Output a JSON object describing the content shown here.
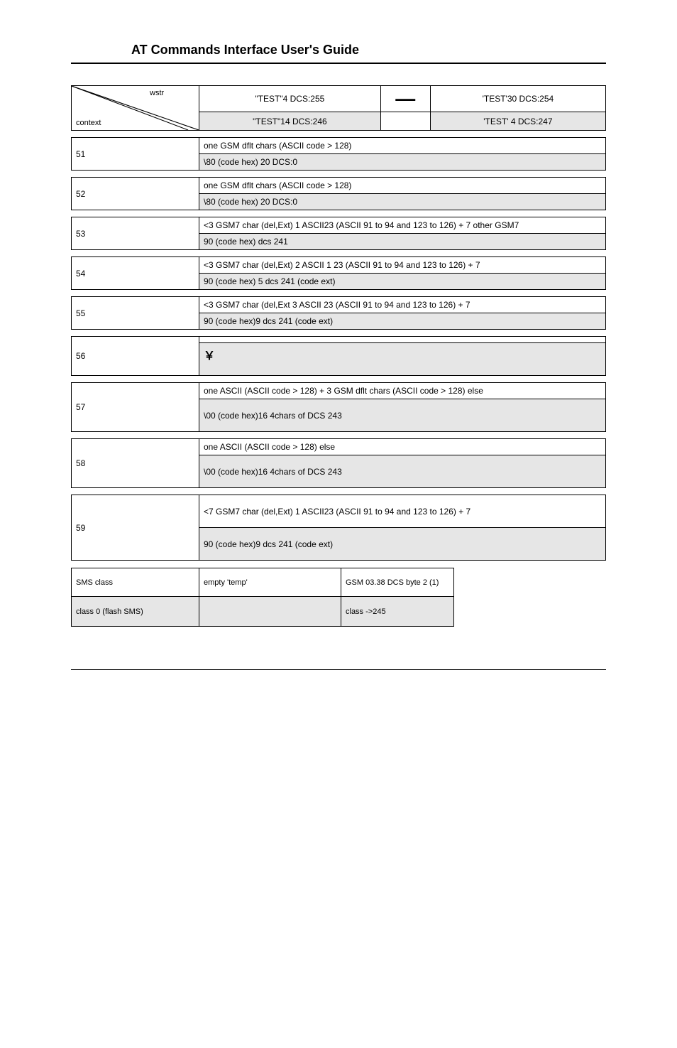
{
  "header": {
    "title": "AT Commands Interface User's Guide"
  },
  "diag": {
    "top": "wstr",
    "bottom": "context"
  },
  "columns": {
    "c1": "\"TEST\"4 DCS:255",
    "c2": "—",
    "c3": "'TEST'30 DCS:254"
  },
  "headrow2": {
    "c1": "\"TEST\"14 DCS:246",
    "c2": "",
    "c3": "'TEST' 4 DCS:247"
  },
  "sections": [
    {
      "num": "51",
      "white": "one GSM dflt chars (ASCII code > 128)",
      "grey": "\\80 (code hex) 20 DCS:0"
    },
    {
      "num": "52",
      "white": "one GSM dflt chars (ASCII code > 128)",
      "grey": "\\80 (code hex) 20 DCS:0"
    },
    {
      "num": "53",
      "white": "<3 GSM7 char (del,Ext) 1 ASCII23 (ASCII 91 to 94 and 123 to 126) + 7 other GSM7",
      "grey": "90 (code hex) dcs 241"
    },
    {
      "num": "54",
      "white": "<3 GSM7 char (del,Ext) 2 ASCII 1 23 (ASCII 91 to 94 and 123 to 126) + 7",
      "grey": "90 (code hex) 5 dcs 241 (code ext)"
    },
    {
      "num": "55",
      "white": "<3 GSM7 char (del,Ext 3 ASCII 23 (ASCII 91 to 94 and 123 to 126) + 7",
      "grey": "90 (code hex)9 dcs 241 (code ext)"
    },
    {
      "num": "56",
      "white": "",
      "grey": " ￥",
      "greyTall": true
    },
    {
      "num": "57",
      "white": "one ASCII (ASCII code > 128) + 3 GSM dflt chars (ASCII code > 128) else",
      "grey": "\\00 (code hex)16 4chars of DCS 243",
      "whiteTall": false,
      "greyTall": true
    },
    {
      "num": "58",
      "white": "one ASCII (ASCII code > 128) else",
      "grey": "\\00 (code hex)16 4chars of DCS 243",
      "greyTall": true
    },
    {
      "num": "59",
      "white": "<7 GSM7 char (del,Ext) 1 ASCII23 (ASCII 91 to 94 and 123 to 126) + 7",
      "grey": "90 (code hex)9 dcs 241 (code ext)",
      "whiteTall": true,
      "greyTall": true
    }
  ],
  "bottom": {
    "headers": [
      "SMS class",
      "empty 'temp'",
      "GSM 03.38 DCS byte 2 (1)"
    ],
    "row": [
      "class 0 (flash SMS)",
      "",
      "class ->245"
    ]
  },
  "footer": {
    "pageinfo": ""
  }
}
